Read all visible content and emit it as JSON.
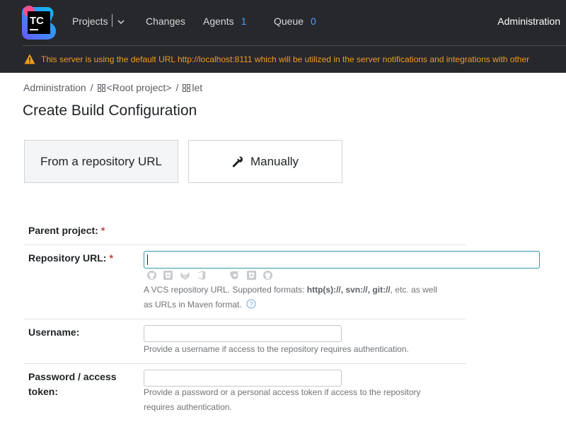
{
  "header": {
    "logo_text": "TC",
    "nav": {
      "projects": "Projects",
      "changes": "Changes",
      "agents": "Agents",
      "agents_count": "1",
      "queue": "Queue",
      "queue_count": "0"
    },
    "admin": "Administration"
  },
  "warning": {
    "text": "This server is using the default URL http://localhost:8111 which will be utilized in the server notifications and integrations with other"
  },
  "breadcrumb": {
    "items": [
      "Administration",
      "<Root project>",
      "let"
    ],
    "separator": "/"
  },
  "page": {
    "title": "Create Build Configuration"
  },
  "tabs": [
    {
      "label": "From a repository URL",
      "selected": true
    },
    {
      "label": "Manually",
      "selected": false
    }
  ],
  "form": {
    "required_mark": "*",
    "parent_project": {
      "label": "Parent project:"
    },
    "repository_url": {
      "label": "Repository URL:",
      "value": "",
      "vcs_icons": [
        "github-icon",
        "bitbucket-icon",
        "gitlab-icon",
        "azure-devops-icon",
        "gitea-icon",
        "space-icon",
        "bitbucket-server-icon",
        "github-enterprise-icon"
      ],
      "hint_prefix": "A VCS repository URL. Supported formats: ",
      "hint_formats": "http(s)://, svn://, git://",
      "hint_suffix": ", etc. as well",
      "hint_line2": "as URLs in Maven format."
    },
    "username": {
      "label": "Username:",
      "value": "",
      "hint": "Provide a username if access to the repository requires authentication."
    },
    "password": {
      "label_line1": "Password / access",
      "label_line2": "token:",
      "value": "",
      "hint_line1": "Provide a password or a personal access token if access to the repository",
      "hint_line2": "requires authentication."
    }
  }
}
